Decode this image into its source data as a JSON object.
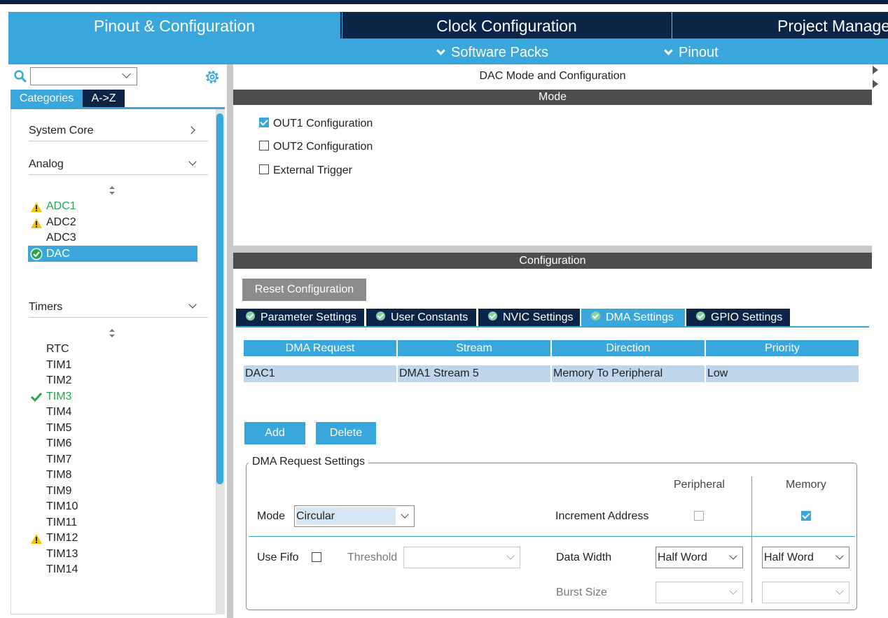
{
  "top_tabs": [
    {
      "label": "Pinout & Configuration",
      "active": true
    },
    {
      "label": "Clock Configuration",
      "active": false
    },
    {
      "label": "Project Manage",
      "active": false
    }
  ],
  "sub_nav": [
    {
      "label": "Software Packs"
    },
    {
      "label": "Pinout"
    }
  ],
  "left_panel": {
    "search": {
      "value": "",
      "placeholder": ""
    },
    "tabs": [
      {
        "label": "Categories",
        "active": true
      },
      {
        "label": "A->Z",
        "active": false
      }
    ],
    "categories": [
      {
        "label": "System Core",
        "expanded": false
      },
      {
        "label": "Analog",
        "expanded": true
      },
      {
        "label": "Timers",
        "expanded": true
      }
    ],
    "analog_items": [
      {
        "label": "ADC1",
        "status": "warning"
      },
      {
        "label": "ADC2",
        "status": "warning"
      },
      {
        "label": "ADC3",
        "status": "none"
      },
      {
        "label": "DAC",
        "status": "ok-selected"
      }
    ],
    "timer_items": [
      {
        "label": "RTC",
        "status": "none"
      },
      {
        "label": "TIM1",
        "status": "none"
      },
      {
        "label": "TIM2",
        "status": "none"
      },
      {
        "label": "TIM3",
        "status": "ok"
      },
      {
        "label": "TIM4",
        "status": "none"
      },
      {
        "label": "TIM5",
        "status": "none"
      },
      {
        "label": "TIM6",
        "status": "none"
      },
      {
        "label": "TIM7",
        "status": "none"
      },
      {
        "label": "TIM8",
        "status": "none"
      },
      {
        "label": "TIM9",
        "status": "none"
      },
      {
        "label": "TIM10",
        "status": "none"
      },
      {
        "label": "TIM11",
        "status": "none"
      },
      {
        "label": "TIM12",
        "status": "warning"
      },
      {
        "label": "TIM13",
        "status": "none"
      },
      {
        "label": "TIM14",
        "status": "none"
      }
    ]
  },
  "main": {
    "title": "DAC Mode and Configuration",
    "mode_header": "Mode",
    "mode_options": [
      {
        "label": "OUT1 Configuration",
        "checked": true
      },
      {
        "label": "OUT2 Configuration",
        "checked": false
      },
      {
        "label": "External Trigger",
        "checked": false
      }
    ],
    "config_header": "Configuration",
    "reset_button": "Reset Configuration",
    "config_tabs": [
      {
        "label": "Parameter Settings",
        "active": false
      },
      {
        "label": "User Constants",
        "active": false
      },
      {
        "label": "NVIC Settings",
        "active": false
      },
      {
        "label": "DMA Settings",
        "active": true
      },
      {
        "label": "GPIO Settings",
        "active": false
      }
    ],
    "dma_table": {
      "headers": [
        "DMA Request",
        "Stream",
        "Direction",
        "Priority"
      ],
      "rows": [
        [
          "DAC1",
          "DMA1 Stream 5",
          "Memory To Peripheral",
          "Low"
        ]
      ]
    },
    "add_button": "Add",
    "delete_button": "Delete",
    "request_settings": {
      "legend": "DMA Request Settings",
      "peripheral_header": "Peripheral",
      "memory_header": "Memory",
      "mode_label": "Mode",
      "mode_value": "Circular",
      "increment_label": "Increment Address",
      "increment_peripheral": false,
      "increment_memory": true,
      "use_fifo_label": "Use Fifo",
      "use_fifo": false,
      "threshold_label": "Threshold",
      "threshold_value": "",
      "data_width_label": "Data Width",
      "data_width_peripheral": "Half Word",
      "data_width_memory": "Half Word",
      "burst_size_label": "Burst Size",
      "burst_peripheral": "",
      "burst_memory": ""
    }
  },
  "colors": {
    "navy": "#0b2447",
    "accent_blue": "#3aa7dc",
    "ok_green": "#2aa44a",
    "warning_yellow": "#f5c400",
    "header_grey": "#4d4d4d"
  }
}
